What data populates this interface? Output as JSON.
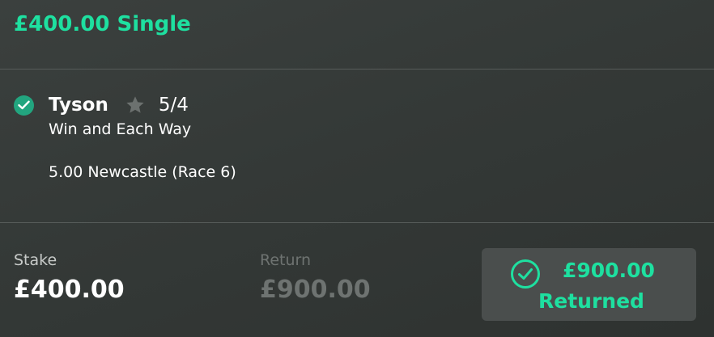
{
  "bet": {
    "title": "£400.00 Single"
  },
  "selection": {
    "name": "Tyson",
    "odds": "5/4",
    "market": "Win and Each Way",
    "event": "5.00 Newcastle (Race 6)",
    "status_icon": "check-circle-icon",
    "favourite_icon": "star-icon"
  },
  "summary": {
    "stake_label": "Stake",
    "stake_value": "£400.00",
    "return_label": "Return",
    "return_value": "£900.00",
    "returned_amount": "£900.00",
    "returned_text": "Returned",
    "returned_icon": "check-circle-outline-icon"
  },
  "colors": {
    "accent": "#1ee0a0",
    "check_fill": "#22a57f",
    "muted": "#6e7371"
  }
}
